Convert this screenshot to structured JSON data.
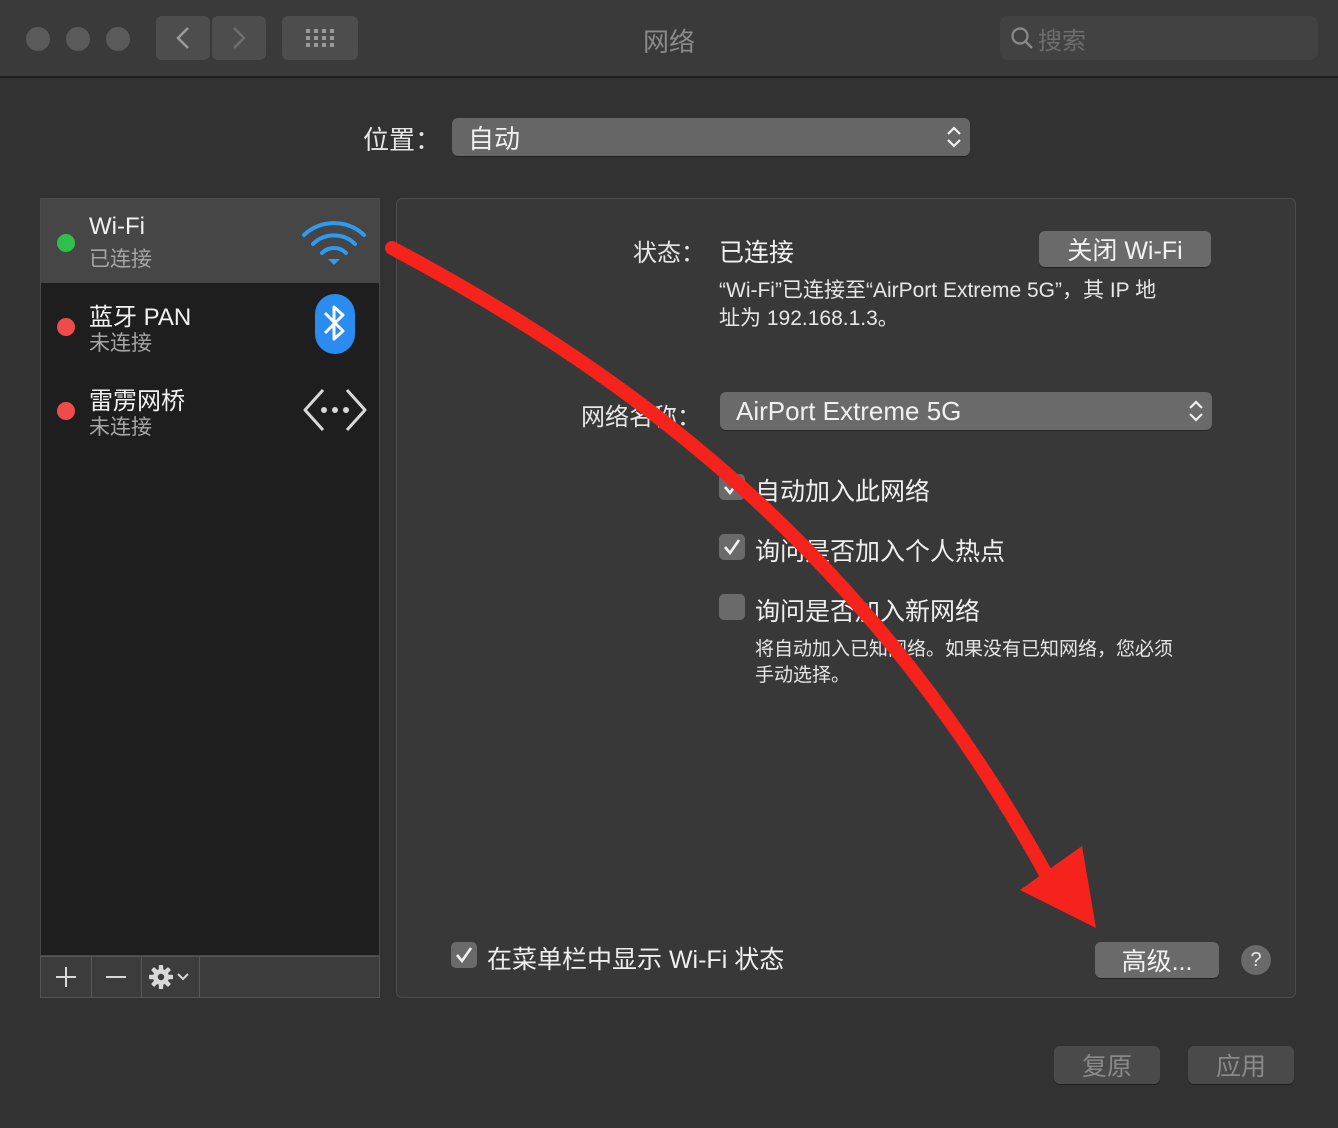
{
  "window": {
    "title": "网络",
    "search_placeholder": "搜索"
  },
  "location": {
    "label": "位置：",
    "value": "自动"
  },
  "services": [
    {
      "name": "Wi-Fi",
      "status": "已连接",
      "status_color": "#2fc04a",
      "icon": "wifi-icon"
    },
    {
      "name": "蓝牙 PAN",
      "status": "未连接",
      "status_color": "#ef4b4b",
      "icon": "bluetooth-icon"
    },
    {
      "name": "雷雳网桥",
      "status": "未连接",
      "status_color": "#ef4b4b",
      "icon": "thunderbolt-bridge-icon"
    }
  ],
  "detail": {
    "status_label": "状态：",
    "status_value": "已连接",
    "turn_off_button": "关闭 Wi-Fi",
    "description_line1": "“Wi-Fi”已连接至“AirPort Extreme 5G”，其 IP 地",
    "description_line2": "址为 192.168.1.3。",
    "network_name_label": "网络名称：",
    "network_name_value": "AirPort Extreme 5G",
    "options": [
      {
        "label": "自动加入此网络",
        "checked": true
      },
      {
        "label": "询问是否加入个人热点",
        "checked": true
      },
      {
        "label": "询问是否加入新网络",
        "checked": false
      }
    ],
    "note_line1": "将自动加入已知网络。如果没有已知网络，您必须",
    "note_line2": "手动选择。",
    "show_in_menubar": "在菜单栏中显示 Wi-Fi 状态",
    "advanced_button": "高级...",
    "help_button": "?"
  },
  "footer": {
    "revert_button": "复原",
    "apply_button": "应用"
  },
  "annotation": {
    "arrow_color": "#f5231b"
  }
}
